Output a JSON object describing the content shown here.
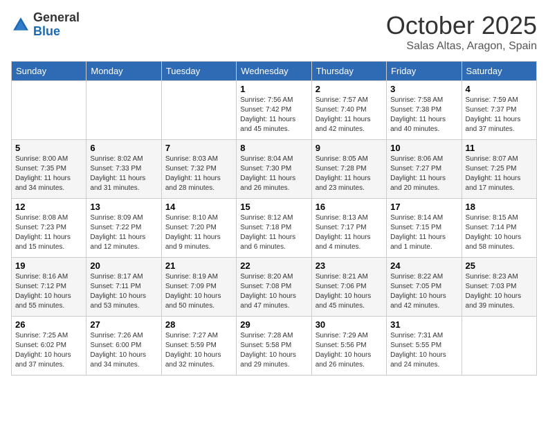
{
  "header": {
    "logo_general": "General",
    "logo_blue": "Blue",
    "month_title": "October 2025",
    "location": "Salas Altas, Aragon, Spain"
  },
  "weekdays": [
    "Sunday",
    "Monday",
    "Tuesday",
    "Wednesday",
    "Thursday",
    "Friday",
    "Saturday"
  ],
  "weeks": [
    [
      {
        "day": "",
        "sunrise": "",
        "sunset": "",
        "daylight": ""
      },
      {
        "day": "",
        "sunrise": "",
        "sunset": "",
        "daylight": ""
      },
      {
        "day": "",
        "sunrise": "",
        "sunset": "",
        "daylight": ""
      },
      {
        "day": "1",
        "sunrise": "Sunrise: 7:56 AM",
        "sunset": "Sunset: 7:42 PM",
        "daylight": "Daylight: 11 hours and 45 minutes."
      },
      {
        "day": "2",
        "sunrise": "Sunrise: 7:57 AM",
        "sunset": "Sunset: 7:40 PM",
        "daylight": "Daylight: 11 hours and 42 minutes."
      },
      {
        "day": "3",
        "sunrise": "Sunrise: 7:58 AM",
        "sunset": "Sunset: 7:38 PM",
        "daylight": "Daylight: 11 hours and 40 minutes."
      },
      {
        "day": "4",
        "sunrise": "Sunrise: 7:59 AM",
        "sunset": "Sunset: 7:37 PM",
        "daylight": "Daylight: 11 hours and 37 minutes."
      }
    ],
    [
      {
        "day": "5",
        "sunrise": "Sunrise: 8:00 AM",
        "sunset": "Sunset: 7:35 PM",
        "daylight": "Daylight: 11 hours and 34 minutes."
      },
      {
        "day": "6",
        "sunrise": "Sunrise: 8:02 AM",
        "sunset": "Sunset: 7:33 PM",
        "daylight": "Daylight: 11 hours and 31 minutes."
      },
      {
        "day": "7",
        "sunrise": "Sunrise: 8:03 AM",
        "sunset": "Sunset: 7:32 PM",
        "daylight": "Daylight: 11 hours and 28 minutes."
      },
      {
        "day": "8",
        "sunrise": "Sunrise: 8:04 AM",
        "sunset": "Sunset: 7:30 PM",
        "daylight": "Daylight: 11 hours and 26 minutes."
      },
      {
        "day": "9",
        "sunrise": "Sunrise: 8:05 AM",
        "sunset": "Sunset: 7:28 PM",
        "daylight": "Daylight: 11 hours and 23 minutes."
      },
      {
        "day": "10",
        "sunrise": "Sunrise: 8:06 AM",
        "sunset": "Sunset: 7:27 PM",
        "daylight": "Daylight: 11 hours and 20 minutes."
      },
      {
        "day": "11",
        "sunrise": "Sunrise: 8:07 AM",
        "sunset": "Sunset: 7:25 PM",
        "daylight": "Daylight: 11 hours and 17 minutes."
      }
    ],
    [
      {
        "day": "12",
        "sunrise": "Sunrise: 8:08 AM",
        "sunset": "Sunset: 7:23 PM",
        "daylight": "Daylight: 11 hours and 15 minutes."
      },
      {
        "day": "13",
        "sunrise": "Sunrise: 8:09 AM",
        "sunset": "Sunset: 7:22 PM",
        "daylight": "Daylight: 11 hours and 12 minutes."
      },
      {
        "day": "14",
        "sunrise": "Sunrise: 8:10 AM",
        "sunset": "Sunset: 7:20 PM",
        "daylight": "Daylight: 11 hours and 9 minutes."
      },
      {
        "day": "15",
        "sunrise": "Sunrise: 8:12 AM",
        "sunset": "Sunset: 7:18 PM",
        "daylight": "Daylight: 11 hours and 6 minutes."
      },
      {
        "day": "16",
        "sunrise": "Sunrise: 8:13 AM",
        "sunset": "Sunset: 7:17 PM",
        "daylight": "Daylight: 11 hours and 4 minutes."
      },
      {
        "day": "17",
        "sunrise": "Sunrise: 8:14 AM",
        "sunset": "Sunset: 7:15 PM",
        "daylight": "Daylight: 11 hours and 1 minute."
      },
      {
        "day": "18",
        "sunrise": "Sunrise: 8:15 AM",
        "sunset": "Sunset: 7:14 PM",
        "daylight": "Daylight: 10 hours and 58 minutes."
      }
    ],
    [
      {
        "day": "19",
        "sunrise": "Sunrise: 8:16 AM",
        "sunset": "Sunset: 7:12 PM",
        "daylight": "Daylight: 10 hours and 55 minutes."
      },
      {
        "day": "20",
        "sunrise": "Sunrise: 8:17 AM",
        "sunset": "Sunset: 7:11 PM",
        "daylight": "Daylight: 10 hours and 53 minutes."
      },
      {
        "day": "21",
        "sunrise": "Sunrise: 8:19 AM",
        "sunset": "Sunset: 7:09 PM",
        "daylight": "Daylight: 10 hours and 50 minutes."
      },
      {
        "day": "22",
        "sunrise": "Sunrise: 8:20 AM",
        "sunset": "Sunset: 7:08 PM",
        "daylight": "Daylight: 10 hours and 47 minutes."
      },
      {
        "day": "23",
        "sunrise": "Sunrise: 8:21 AM",
        "sunset": "Sunset: 7:06 PM",
        "daylight": "Daylight: 10 hours and 45 minutes."
      },
      {
        "day": "24",
        "sunrise": "Sunrise: 8:22 AM",
        "sunset": "Sunset: 7:05 PM",
        "daylight": "Daylight: 10 hours and 42 minutes."
      },
      {
        "day": "25",
        "sunrise": "Sunrise: 8:23 AM",
        "sunset": "Sunset: 7:03 PM",
        "daylight": "Daylight: 10 hours and 39 minutes."
      }
    ],
    [
      {
        "day": "26",
        "sunrise": "Sunrise: 7:25 AM",
        "sunset": "Sunset: 6:02 PM",
        "daylight": "Daylight: 10 hours and 37 minutes."
      },
      {
        "day": "27",
        "sunrise": "Sunrise: 7:26 AM",
        "sunset": "Sunset: 6:00 PM",
        "daylight": "Daylight: 10 hours and 34 minutes."
      },
      {
        "day": "28",
        "sunrise": "Sunrise: 7:27 AM",
        "sunset": "Sunset: 5:59 PM",
        "daylight": "Daylight: 10 hours and 32 minutes."
      },
      {
        "day": "29",
        "sunrise": "Sunrise: 7:28 AM",
        "sunset": "Sunset: 5:58 PM",
        "daylight": "Daylight: 10 hours and 29 minutes."
      },
      {
        "day": "30",
        "sunrise": "Sunrise: 7:29 AM",
        "sunset": "Sunset: 5:56 PM",
        "daylight": "Daylight: 10 hours and 26 minutes."
      },
      {
        "day": "31",
        "sunrise": "Sunrise: 7:31 AM",
        "sunset": "Sunset: 5:55 PM",
        "daylight": "Daylight: 10 hours and 24 minutes."
      },
      {
        "day": "",
        "sunrise": "",
        "sunset": "",
        "daylight": ""
      }
    ]
  ]
}
